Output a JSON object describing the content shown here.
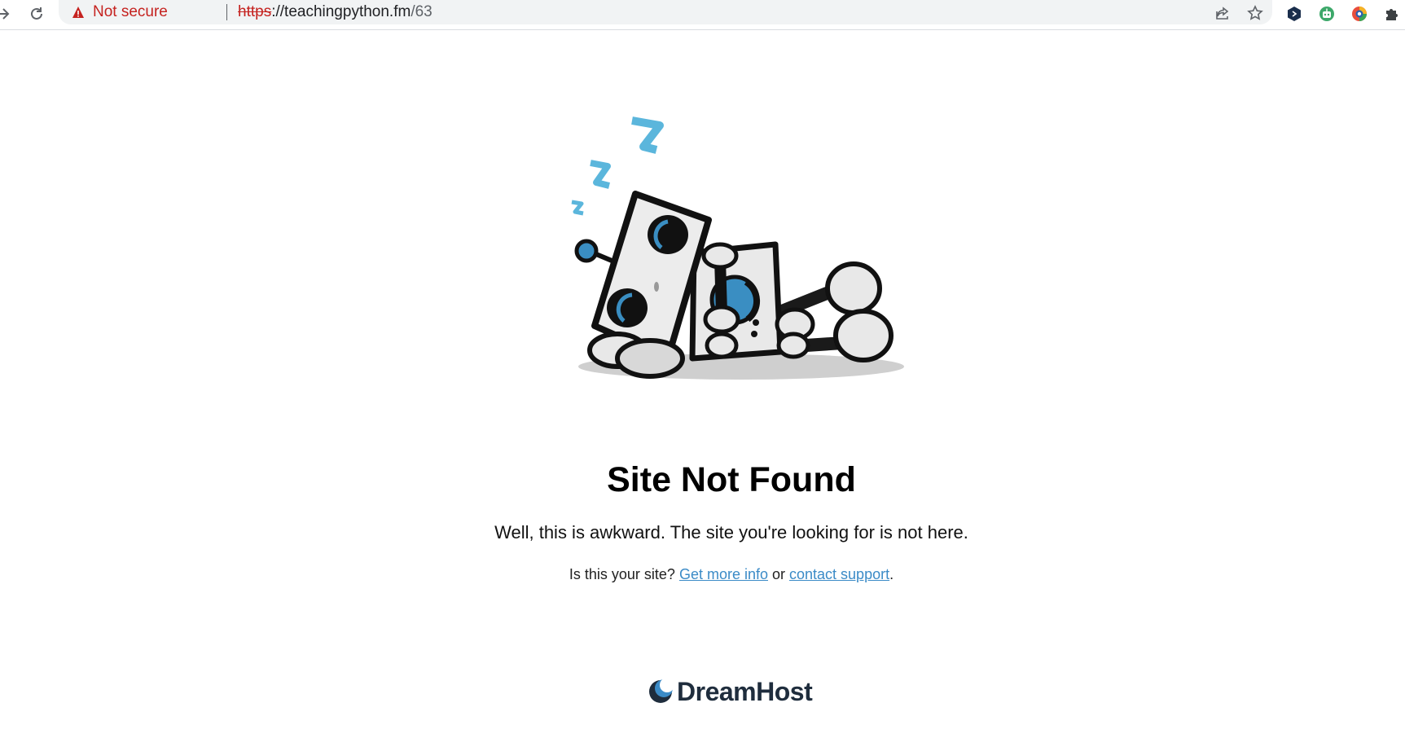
{
  "browser": {
    "security_label": "Not secure",
    "url_scheme": "https",
    "url_rest": "://teachingpython.fm",
    "url_path": "/63",
    "icons": {
      "back": "back-arrow-icon",
      "reload": "reload-icon",
      "warning": "warning-triangle-icon",
      "share": "share-icon",
      "bookmark": "bookmark-star-icon",
      "extensions": [
        "hexagon-extension-icon",
        "robot-extension-icon",
        "color-picker-extension-icon",
        "puzzle-extensions-icon"
      ]
    }
  },
  "page": {
    "title": "Site Not Found",
    "subtitle": "Well, this is awkward. The site you're looking for is not here.",
    "help_prefix": "Is this your site? ",
    "link_more_info": "Get more info",
    "help_or": " or ",
    "link_support": "contact support",
    "help_suffix": ".",
    "brand": "DreamHost",
    "illustration": "sleeping-robot-illustration"
  },
  "colors": {
    "accent_blue": "#3b8bc7",
    "zzz_blue": "#5bb6dc",
    "warning_red": "#c5221f",
    "brand_dark": "#1f2d3d"
  }
}
